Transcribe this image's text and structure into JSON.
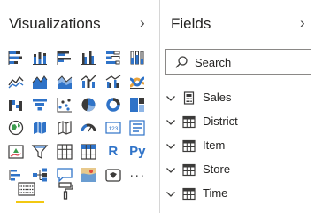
{
  "visualizations": {
    "title": "Visualizations",
    "tiles": [
      {
        "icon": "stacked-bar-chart-icon"
      },
      {
        "icon": "stacked-column-chart-icon"
      },
      {
        "icon": "clustered-bar-chart-icon"
      },
      {
        "icon": "clustered-column-chart-icon"
      },
      {
        "icon": "100-stacked-bar-chart-icon"
      },
      {
        "icon": "100-stacked-column-chart-icon"
      },
      {
        "icon": "line-chart-icon"
      },
      {
        "icon": "area-chart-icon"
      },
      {
        "icon": "stacked-area-chart-icon"
      },
      {
        "icon": "line-and-stacked-column-chart-icon"
      },
      {
        "icon": "line-and-clustered-column-chart-icon"
      },
      {
        "icon": "ribbon-chart-icon"
      },
      {
        "icon": "waterfall-chart-icon"
      },
      {
        "icon": "funnel-chart-icon"
      },
      {
        "icon": "scatter-chart-icon"
      },
      {
        "icon": "pie-chart-icon"
      },
      {
        "icon": "donut-chart-icon"
      },
      {
        "icon": "treemap-icon"
      },
      {
        "icon": "map-icon"
      },
      {
        "icon": "filled-map-icon"
      },
      {
        "icon": "shape-map-icon"
      },
      {
        "icon": "gauge-icon"
      },
      {
        "icon": "card-icon",
        "text": "123"
      },
      {
        "icon": "multi-row-card-icon"
      },
      {
        "icon": "kpi-icon"
      },
      {
        "icon": "slicer-icon"
      },
      {
        "icon": "table-icon"
      },
      {
        "icon": "matrix-icon"
      },
      {
        "icon": "r-visual-icon",
        "text": "R"
      },
      {
        "icon": "python-visual-icon",
        "text": "Py"
      },
      {
        "icon": "key-influencers-icon"
      },
      {
        "icon": "decomposition-tree-icon"
      },
      {
        "icon": "qa-icon"
      },
      {
        "icon": "arcgis-map-icon"
      },
      {
        "icon": "power-apps-icon"
      },
      {
        "icon": "more-visuals-icon",
        "text": "···"
      }
    ],
    "tabs": [
      {
        "icon": "fields-tab-icon",
        "active": true
      },
      {
        "icon": "format-paint-roller-icon",
        "active": false
      }
    ]
  },
  "fields": {
    "title": "Fields",
    "search": {
      "placeholder": "Search",
      "value": ""
    },
    "tables": [
      {
        "name": "Sales",
        "icon": "calculator-icon"
      },
      {
        "name": "District",
        "icon": "table-icon"
      },
      {
        "name": "Item",
        "icon": "table-icon"
      },
      {
        "name": "Store",
        "icon": "table-icon"
      },
      {
        "name": "Time",
        "icon": "table-icon"
      }
    ]
  },
  "colors": {
    "accent": "#f2c811",
    "icon_blue": "#2f73c8",
    "icon_dark": "#3b3a39"
  }
}
